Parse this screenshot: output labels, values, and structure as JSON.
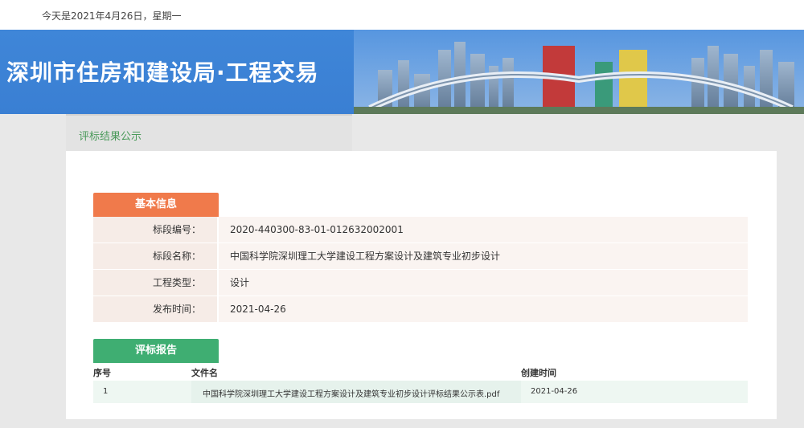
{
  "topbar": {
    "date_text": "今天是2021年4月26日，星期一"
  },
  "banner": {
    "title": "深圳市住房和建设局·工程交易"
  },
  "tab": {
    "label": "评标结果公示"
  },
  "basic_info": {
    "section_title": "基本信息",
    "rows": [
      {
        "label": "标段编号：",
        "value": "2020-440300-83-01-012632002001"
      },
      {
        "label": "标段名称：",
        "value": "中国科学院深圳理工大学建设工程方案设计及建筑专业初步设计"
      },
      {
        "label": "工程类型：",
        "value": "设计"
      },
      {
        "label": "发布时间：",
        "value": "2021-04-26"
      }
    ]
  },
  "report": {
    "section_title": "评标报告",
    "columns": [
      "序号",
      "文件名",
      "创建时间"
    ],
    "rows": [
      {
        "index": "1",
        "file_name": "中国科学院深圳理工大学建设工程方案设计及建筑专业初步设计评标结果公示表.pdf",
        "created": "2021-04-26"
      }
    ]
  },
  "colors": {
    "banner_blue": "#3f86d8",
    "basic_header": "#f07a4b",
    "report_header": "#3fae72",
    "tab_text": "#4a9a5a"
  }
}
